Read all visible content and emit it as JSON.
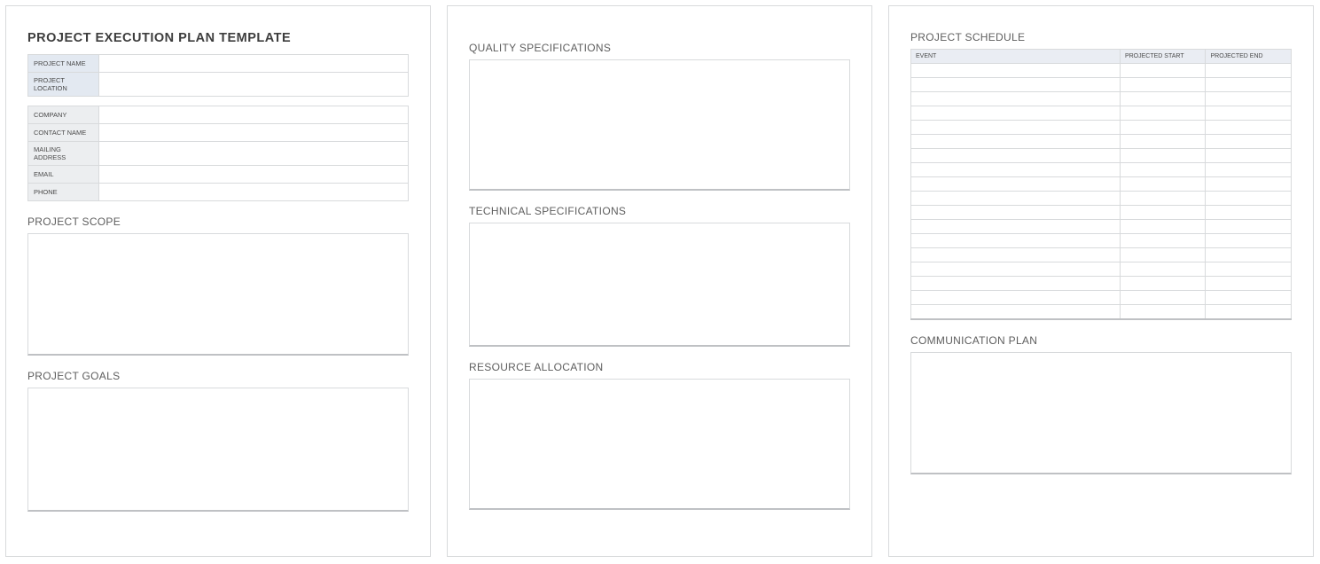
{
  "title": "PROJECT EXECUTION PLAN TEMPLATE",
  "header_fields": {
    "name_label": "PROJECT NAME",
    "name_value": "",
    "location_label": "PROJECT LOCATION",
    "location_value": ""
  },
  "contact_fields": {
    "company_label": "COMPANY",
    "company_value": "",
    "contact_label": "CONTACT NAME",
    "contact_value": "",
    "address_label": "MAILING ADDRESS",
    "address_value": "",
    "email_label": "EMAIL",
    "email_value": "",
    "phone_label": "PHONE",
    "phone_value": ""
  },
  "sections": {
    "scope": "PROJECT SCOPE",
    "goals": "PROJECT GOALS",
    "quality": "QUALITY SPECIFICATIONS",
    "technical": "TECHNICAL SPECIFICATIONS",
    "resource": "RESOURCE ALLOCATION",
    "schedule": "PROJECT SCHEDULE",
    "communication": "COMMUNICATION PLAN"
  },
  "schedule_headers": {
    "event": "EVENT",
    "start": "PROJECTED START",
    "end": "PROJECTED END"
  },
  "schedule_rows": 18
}
